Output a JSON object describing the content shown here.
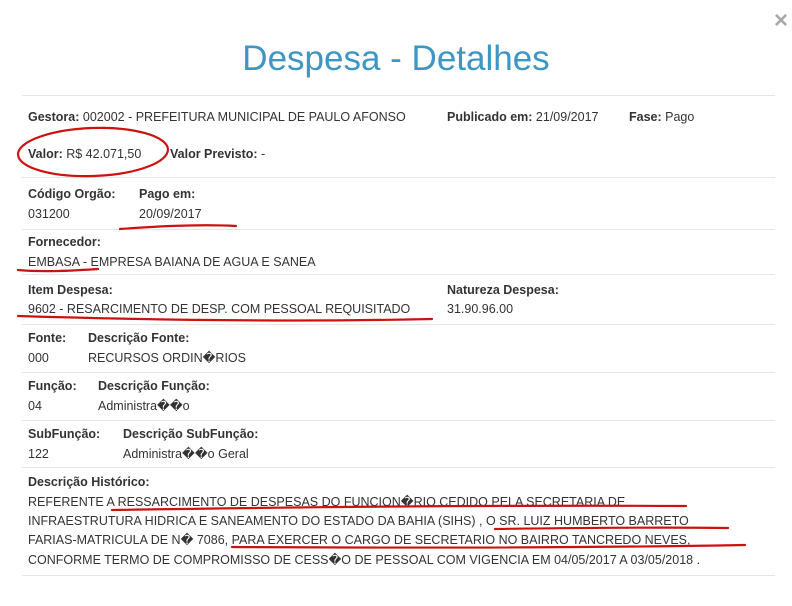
{
  "close_icon": "×",
  "title": "Despesa - Detalhes",
  "gestora": {
    "label": "Gestora:",
    "value": "002002 - PREFEITURA MUNICIPAL DE PAULO AFONSO"
  },
  "publicado": {
    "label": "Publicado em:",
    "value": "21/09/2017"
  },
  "fase": {
    "label": "Fase:",
    "value": "Pago"
  },
  "valor": {
    "label": "Valor:",
    "value": "R$ 42.071,50"
  },
  "valor_previsto": {
    "label": "Valor Previsto:",
    "value": "-"
  },
  "codigo_orgao": {
    "label": "Código Orgão:",
    "value": "031200"
  },
  "pago_em": {
    "label": "Pago em:",
    "value": "20/09/2017"
  },
  "fornecedor": {
    "label": "Fornecedor:",
    "value": "EMBASA - EMPRESA BAIANA DE AGUA E SANEA"
  },
  "item_despesa": {
    "label": "Item Despesa:",
    "value": "9602 - RESARCIMENTO DE DESP. COM PESSOAL REQUISITADO"
  },
  "natureza": {
    "label": "Natureza Despesa:",
    "value": "31.90.96.00"
  },
  "fonte": {
    "label": "Fonte:",
    "value": "000"
  },
  "descricao_fonte": {
    "label": "Descrição Fonte:",
    "value": "RECURSOS ORDIN�RIOS"
  },
  "funcao": {
    "label": "Função:",
    "value": "04"
  },
  "descricao_funcao": {
    "label": "Descrição Função:",
    "value": "Administra��o"
  },
  "subfuncao": {
    "label": "SubFunção:",
    "value": "122"
  },
  "descricao_subfuncao": {
    "label": "Descrição SubFunção:",
    "value": "Administra��o Geral"
  },
  "historico": {
    "label": "Descrição Histórico:",
    "lines": [
      "REFERENTE A RESSARCIMENTO DE DESPESAS DO FUNCION�RIO CEDIDO PELA SECRETARIA DE",
      "INFRAESTRUTURA HIDRICA E SANEAMENTO DO ESTADO DA BAHIA (SIHS) , O SR. LUIZ HUMBERTO BARRETO",
      "FARIAS-MATRICULA DE N� 7086, PARA EXERCER O CARGO DE SECRETARIO NO BAIRRO TANCREDO NEVES,",
      "CONFORME TERMO DE COMPROMISSO DE CESS�O DE PESSOAL COM VIGENCIA EM 04/05/2017 A 03/05/2018 ."
    ]
  },
  "annotation_color": "#cc1111"
}
